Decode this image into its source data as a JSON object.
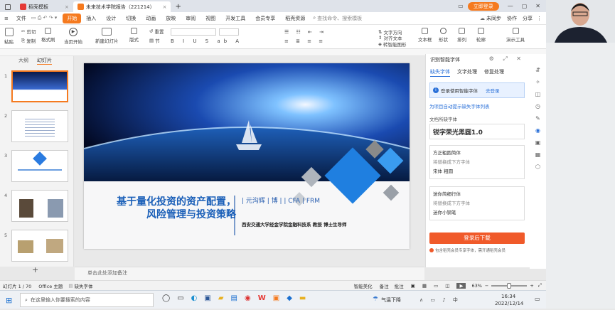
{
  "tabs": [
    {
      "label": "稻壳模板",
      "color": "#e53935"
    },
    {
      "label": "未来技术学院报告（221214）",
      "color": "#f57a1f"
    }
  ],
  "titlebar": {
    "login": "立即登录"
  },
  "menus": [
    "文件",
    "开始",
    "插入",
    "设计",
    "切换",
    "动画",
    "放映",
    "审阅",
    "视图",
    "开发工具",
    "会员专享",
    "稻壳资源"
  ],
  "search_placeholder": "查找命令、搜索模板",
  "menu_right": {
    "sync": "未同步",
    "collab": "协作",
    "share": "分享"
  },
  "ribbon": {
    "cut": "剪切",
    "copy": "复制",
    "format": "格式刷",
    "paste": "粘贴",
    "play_current": "当页开始",
    "new_slide": "新建幻灯片",
    "layout": "版式",
    "section": "节",
    "reset": "重置",
    "text_dir": "文字方向",
    "align_text": "对齐文本",
    "convert_smart": "转智能图形",
    "textbox": "文本框",
    "shape": "形状",
    "arrange": "排列",
    "outline": "轮廓",
    "lecture": "演示工具"
  },
  "left_tabs": {
    "outline": "大纲",
    "slides": "幻灯片"
  },
  "slide_numbers": [
    "1",
    "2",
    "3",
    "4",
    "5"
  ],
  "slide": {
    "title_line1": "基于量化投资的资产配置，",
    "title_line2": "风险管理与投资策略",
    "tags": "| 元沟辉 | 博 | | CFA | FRM",
    "subtitle": "西安交通大学经金学院金融科技系 教授 博士生导师"
  },
  "notes_placeholder": "单击此处添加备注",
  "right_pane": {
    "title": "识别智能字体",
    "tabs": [
      "缺失字体",
      "文字处理",
      "修复处理"
    ],
    "notice": "登录使用智能字体",
    "notice_link": "去登录",
    "link": "为项目自动提示缺失字体列表",
    "section": "文档所缺字体",
    "font1": "锐字荣光黑圆1.0",
    "font2_title": "方正粗圆简体",
    "font2_hint": "将替换成下方字体",
    "font2_alt": "宋体 粗圆",
    "font3_title": "迷你简细行体",
    "font3_hint": "将替换成下方字体",
    "font3_alt": "迷你小钢笔",
    "download_button": "登录后下载",
    "footer": "包含稻壳会员专享字体，需开通稻壳会员"
  },
  "status": {
    "slide_info": "幻灯片 1 / 70",
    "theme": "Office 主题",
    "missing_font": "缺失字体",
    "smart": "智能美化",
    "notes": "备注",
    "comments": "批注",
    "zoom": "63%"
  },
  "taskbar": {
    "search_placeholder": "在这里输入你要搜索的内容",
    "weather": "气温下降",
    "time": "16:34",
    "date": "2022/12/14"
  }
}
